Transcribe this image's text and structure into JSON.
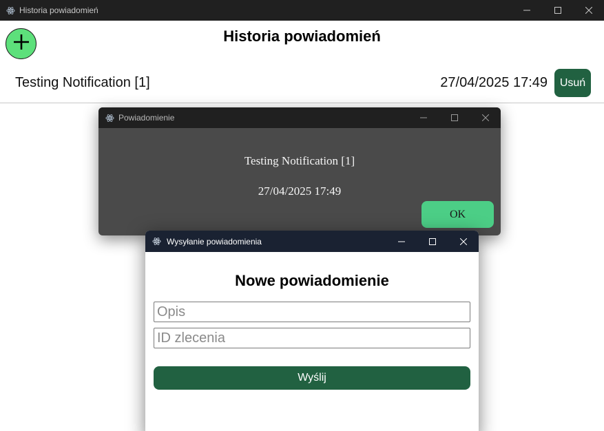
{
  "main_window": {
    "title": "Historia powiadomień",
    "icon": "electron-logo-icon",
    "controls": [
      "minimize-icon",
      "maximize-icon",
      "close-icon"
    ]
  },
  "header": {
    "add_button_icon": "plus-icon",
    "title": "Historia powiadomień"
  },
  "notifications": [
    {
      "label": "Testing Notification [1]",
      "date": "27/04/2025 17:49",
      "delete_label": "Usuń"
    }
  ],
  "popup": {
    "title": "Powiadomienie",
    "message": "Testing Notification [1]",
    "date": "27/04/2025 17:49",
    "ok_label": "OK"
  },
  "send_dialog": {
    "title": "Wysyłanie powiadomienia",
    "heading": "Nowe powiadomienie",
    "description_placeholder": "Opis",
    "order_id_placeholder": "ID zlecenia",
    "send_label": "Wyślij"
  },
  "colors": {
    "add_button": "#5de07b",
    "primary_green": "#216141",
    "ok_green": "#4cce86",
    "popup_bg": "#4a4a4a",
    "dialog_titlebar": "#1a2232"
  }
}
